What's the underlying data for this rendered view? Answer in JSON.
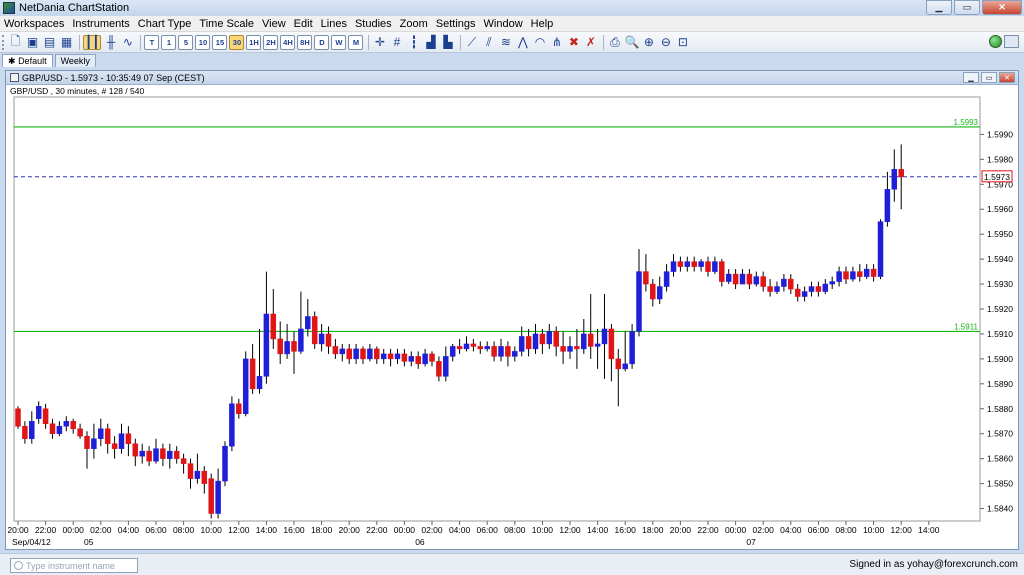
{
  "app": {
    "title": "NetDania ChartStation"
  },
  "window_controls": {
    "minimize": "▁",
    "maximize": "▭",
    "close": "✕"
  },
  "menu": [
    "Workspaces",
    "Instruments",
    "Chart Type",
    "Time Scale",
    "View",
    "Edit",
    "Lines",
    "Studies",
    "Zoom",
    "Settings",
    "Window",
    "Help"
  ],
  "toolbar": {
    "timeframes": [
      "T",
      "1",
      "5",
      "10",
      "15",
      "30",
      "1H",
      "2H",
      "4H",
      "8H",
      "D",
      "W",
      "M"
    ],
    "selected_timeframe": "30"
  },
  "tabs": [
    {
      "label": "Default",
      "star": "✱"
    },
    {
      "label": "Weekly",
      "star": ""
    }
  ],
  "chart_window": {
    "title": "GBP/USD - 1.5973 - 10:35:49  07 Sep (CEST)",
    "subtitle": "GBP/USD , 30 minutes, # 128 / 540",
    "controls": {
      "minimize": "▁",
      "maximize": "▭",
      "close": "✕"
    }
  },
  "search": {
    "placeholder": "Type instrument name"
  },
  "status": {
    "signed_in": "Signed in as yohay@forexcrunch.com"
  },
  "colors": {
    "up": "#1f1fd8",
    "down": "#e01515",
    "hline": "#17b617",
    "last": "#3030c0"
  },
  "chart_data": {
    "type": "candlestick",
    "ylim": [
      1.5835,
      1.6005
    ],
    "y_ticks": [
      "1.5840",
      "1.5850",
      "1.5860",
      "1.5870",
      "1.5880",
      "1.5890",
      "1.5900",
      "1.5910",
      "1.5920",
      "1.5930",
      "1.5940",
      "1.5950",
      "1.5960",
      "1.5970",
      "1.5980",
      "1.5990"
    ],
    "x_ticks": [
      {
        "label": "20:00",
        "index": 0
      },
      {
        "label": "22:00",
        "index": 4
      },
      {
        "label": "00:00",
        "index": 8
      },
      {
        "label": "02:00",
        "index": 12
      },
      {
        "label": "04:00",
        "index": 16
      },
      {
        "label": "06:00",
        "index": 20
      },
      {
        "label": "08:00",
        "index": 24
      },
      {
        "label": "10:00",
        "index": 28
      },
      {
        "label": "12:00",
        "index": 32
      },
      {
        "label": "14:00",
        "index": 36
      },
      {
        "label": "16:00",
        "index": 40
      },
      {
        "label": "18:00",
        "index": 44
      },
      {
        "label": "20:00",
        "index": 48
      },
      {
        "label": "22:00",
        "index": 52
      },
      {
        "label": "00:00",
        "index": 56
      },
      {
        "label": "02:00",
        "index": 60
      },
      {
        "label": "04:00",
        "index": 64
      },
      {
        "label": "06:00",
        "index": 68
      },
      {
        "label": "08:00",
        "index": 72
      },
      {
        "label": "10:00",
        "index": 76
      },
      {
        "label": "12:00",
        "index": 80
      },
      {
        "label": "14:00",
        "index": 84
      },
      {
        "label": "16:00",
        "index": 88
      },
      {
        "label": "18:00",
        "index": 92
      },
      {
        "label": "20:00",
        "index": 96
      },
      {
        "label": "22:00",
        "index": 100
      },
      {
        "label": "00:00",
        "index": 104
      },
      {
        "label": "02:00",
        "index": 108
      },
      {
        "label": "04:00",
        "index": 112
      },
      {
        "label": "06:00",
        "index": 116
      },
      {
        "label": "08:00",
        "index": 120
      },
      {
        "label": "10:00",
        "index": 124
      },
      {
        "label": "12:00",
        "index": 128
      },
      {
        "label": "14:00",
        "index": 132
      }
    ],
    "date_labels": [
      {
        "label": "Sep/04/12",
        "index": 0
      },
      {
        "label": "05",
        "index": 10
      },
      {
        "label": "06",
        "index": 58
      },
      {
        "label": "07",
        "index": 106
      }
    ],
    "hlines": [
      {
        "value": 1.5993,
        "label": "1.5993"
      },
      {
        "value": 1.5911,
        "label": "1.5911"
      }
    ],
    "last_price": {
      "value": 1.5973,
      "label": "1.5973"
    },
    "candles": [
      [
        1.588,
        1.5873,
        1.5881,
        1.5872
      ],
      [
        1.5873,
        1.5868,
        1.5875,
        1.5866
      ],
      [
        1.5868,
        1.5875,
        1.5879,
        1.5866
      ],
      [
        1.5876,
        1.5881,
        1.5883,
        1.5874
      ],
      [
        1.588,
        1.5874,
        1.5882,
        1.5872
      ],
      [
        1.5874,
        1.587,
        1.5876,
        1.5868
      ],
      [
        1.587,
        1.5873,
        1.5875,
        1.5869
      ],
      [
        1.5873,
        1.5875,
        1.5877,
        1.5871
      ],
      [
        1.5875,
        1.5872,
        1.5876,
        1.587
      ],
      [
        1.5872,
        1.5869,
        1.5874,
        1.5868
      ],
      [
        1.5869,
        1.5864,
        1.5871,
        1.5856
      ],
      [
        1.5864,
        1.5868,
        1.5874,
        1.586
      ],
      [
        1.5868,
        1.5872,
        1.5876,
        1.5865
      ],
      [
        1.5872,
        1.5866,
        1.5874,
        1.5862
      ],
      [
        1.5866,
        1.5864,
        1.5869,
        1.586
      ],
      [
        1.5864,
        1.587,
        1.5874,
        1.5862
      ],
      [
        1.587,
        1.5866,
        1.5873,
        1.5861
      ],
      [
        1.5866,
        1.5861,
        1.5868,
        1.5857
      ],
      [
        1.5861,
        1.5863,
        1.5866,
        1.5858
      ],
      [
        1.5863,
        1.5859,
        1.5865,
        1.5857
      ],
      [
        1.5859,
        1.5864,
        1.5868,
        1.5858
      ],
      [
        1.5864,
        1.586,
        1.5866,
        1.5857
      ],
      [
        1.586,
        1.5863,
        1.5866,
        1.5856
      ],
      [
        1.5863,
        1.586,
        1.5865,
        1.5858
      ],
      [
        1.586,
        1.5858,
        1.5862,
        1.5854
      ],
      [
        1.5858,
        1.5852,
        1.586,
        1.5848
      ],
      [
        1.5852,
        1.5855,
        1.5862,
        1.585
      ],
      [
        1.5855,
        1.585,
        1.5857,
        1.5846
      ],
      [
        1.5852,
        1.5838,
        1.5854,
        1.5836
      ],
      [
        1.5838,
        1.5851,
        1.5856,
        1.5836
      ],
      [
        1.5851,
        1.5865,
        1.5867,
        1.5849
      ],
      [
        1.5865,
        1.5882,
        1.5885,
        1.5863
      ],
      [
        1.5882,
        1.5878,
        1.5884,
        1.5876
      ],
      [
        1.5878,
        1.59,
        1.5903,
        1.5877
      ],
      [
        1.59,
        1.5888,
        1.5906,
        1.5886
      ],
      [
        1.5888,
        1.5893,
        1.5912,
        1.5886
      ],
      [
        1.5893,
        1.5918,
        1.5935,
        1.589
      ],
      [
        1.5918,
        1.5908,
        1.5928,
        1.5904
      ],
      [
        1.5908,
        1.5902,
        1.5915,
        1.5898
      ],
      [
        1.5902,
        1.5907,
        1.5914,
        1.59
      ],
      [
        1.5907,
        1.5903,
        1.5911,
        1.5894
      ],
      [
        1.5903,
        1.5912,
        1.5927,
        1.5902
      ],
      [
        1.5912,
        1.5917,
        1.5924,
        1.5909
      ],
      [
        1.5917,
        1.5906,
        1.5919,
        1.5904
      ],
      [
        1.5906,
        1.591,
        1.5914,
        1.5903
      ],
      [
        1.591,
        1.5905,
        1.5913,
        1.5902
      ],
      [
        1.5905,
        1.5902,
        1.5908,
        1.59
      ],
      [
        1.5902,
        1.5904,
        1.5906,
        1.5899
      ],
      [
        1.5904,
        1.59,
        1.5906,
        1.5898
      ],
      [
        1.59,
        1.5904,
        1.5906,
        1.5898
      ],
      [
        1.5904,
        1.59,
        1.5905,
        1.5898
      ],
      [
        1.59,
        1.5904,
        1.5906,
        1.5899
      ],
      [
        1.5904,
        1.59,
        1.5905,
        1.5898
      ],
      [
        1.59,
        1.5902,
        1.5904,
        1.5898
      ],
      [
        1.5902,
        1.59,
        1.5904,
        1.5897
      ],
      [
        1.59,
        1.5902,
        1.5904,
        1.5898
      ],
      [
        1.5902,
        1.5899,
        1.5904,
        1.5897
      ],
      [
        1.5899,
        1.5901,
        1.5903,
        1.5897
      ],
      [
        1.5901,
        1.5898,
        1.5903,
        1.5896
      ],
      [
        1.5898,
        1.5902,
        1.5904,
        1.5897
      ],
      [
        1.5902,
        1.5899,
        1.5903,
        1.5897
      ],
      [
        1.5899,
        1.5893,
        1.5901,
        1.5891
      ],
      [
        1.5893,
        1.5901,
        1.5905,
        1.5891
      ],
      [
        1.5901,
        1.5905,
        1.5906,
        1.5899
      ],
      [
        1.5905,
        1.5904,
        1.5908,
        1.5902
      ],
      [
        1.5904,
        1.5906,
        1.5909,
        1.5903
      ],
      [
        1.5906,
        1.5905,
        1.5908,
        1.5903
      ],
      [
        1.5905,
        1.5904,
        1.5907,
        1.5902
      ],
      [
        1.5904,
        1.5905,
        1.5907,
        1.5903
      ],
      [
        1.5905,
        1.5901,
        1.5907,
        1.5899
      ],
      [
        1.5901,
        1.5905,
        1.5908,
        1.5899
      ],
      [
        1.5905,
        1.5901,
        1.5907,
        1.5897
      ],
      [
        1.5901,
        1.5903,
        1.5905,
        1.5899
      ],
      [
        1.5903,
        1.5909,
        1.5913,
        1.5901
      ],
      [
        1.5909,
        1.5904,
        1.5912,
        1.5901
      ],
      [
        1.5904,
        1.591,
        1.5914,
        1.5902
      ],
      [
        1.591,
        1.5906,
        1.5912,
        1.5902
      ],
      [
        1.5906,
        1.5911,
        1.5914,
        1.5904
      ],
      [
        1.5911,
        1.5905,
        1.5913,
        1.5901
      ],
      [
        1.5905,
        1.5903,
        1.5911,
        1.5898
      ],
      [
        1.5903,
        1.5905,
        1.5909,
        1.59
      ],
      [
        1.5905,
        1.5904,
        1.5912,
        1.5896
      ],
      [
        1.5904,
        1.591,
        1.5916,
        1.5902
      ],
      [
        1.591,
        1.5905,
        1.5926,
        1.59
      ],
      [
        1.5905,
        1.5906,
        1.5912,
        1.5896
      ],
      [
        1.5906,
        1.5912,
        1.5926,
        1.5892
      ],
      [
        1.5912,
        1.59,
        1.5914,
        1.5891
      ],
      [
        1.59,
        1.5896,
        1.5904,
        1.5881
      ],
      [
        1.5896,
        1.5898,
        1.5911,
        1.5895
      ],
      [
        1.5898,
        1.5911,
        1.5914,
        1.5896
      ],
      [
        1.5911,
        1.5935,
        1.5944,
        1.5909
      ],
      [
        1.5935,
        1.593,
        1.5942,
        1.5927
      ],
      [
        1.593,
        1.5924,
        1.5932,
        1.5921
      ],
      [
        1.5924,
        1.5929,
        1.5933,
        1.5922
      ],
      [
        1.5929,
        1.5935,
        1.5938,
        1.5927
      ],
      [
        1.5935,
        1.5939,
        1.5942,
        1.5933
      ],
      [
        1.5939,
        1.5937,
        1.5941,
        1.5935
      ],
      [
        1.5937,
        1.5939,
        1.5941,
        1.5935
      ],
      [
        1.5939,
        1.5937,
        1.5941,
        1.5935
      ],
      [
        1.5937,
        1.5939,
        1.594,
        1.5935
      ],
      [
        1.5939,
        1.5935,
        1.5941,
        1.5933
      ],
      [
        1.5935,
        1.5939,
        1.5941,
        1.5934
      ],
      [
        1.5939,
        1.5931,
        1.594,
        1.5929
      ],
      [
        1.5931,
        1.5934,
        1.5936,
        1.593
      ],
      [
        1.5934,
        1.593,
        1.5936,
        1.5928
      ],
      [
        1.593,
        1.5934,
        1.5936,
        1.593
      ],
      [
        1.5934,
        1.593,
        1.5936,
        1.5928
      ],
      [
        1.593,
        1.5933,
        1.5935,
        1.5929
      ],
      [
        1.5933,
        1.5929,
        1.5935,
        1.5927
      ],
      [
        1.5929,
        1.5927,
        1.5932,
        1.5925
      ],
      [
        1.5927,
        1.5929,
        1.5931,
        1.5926
      ],
      [
        1.5929,
        1.5932,
        1.5934,
        1.5927
      ],
      [
        1.5932,
        1.5928,
        1.5934,
        1.5926
      ],
      [
        1.5928,
        1.5925,
        1.593,
        1.5923
      ],
      [
        1.5925,
        1.5927,
        1.5929,
        1.5923
      ],
      [
        1.5927,
        1.5929,
        1.5931,
        1.5925
      ],
      [
        1.5929,
        1.5927,
        1.5931,
        1.5925
      ],
      [
        1.5927,
        1.593,
        1.5932,
        1.5926
      ],
      [
        1.593,
        1.5931,
        1.5933,
        1.5928
      ],
      [
        1.5931,
        1.5935,
        1.5937,
        1.5929
      ],
      [
        1.5935,
        1.5932,
        1.5937,
        1.593
      ],
      [
        1.5932,
        1.5935,
        1.5937,
        1.5931
      ],
      [
        1.5935,
        1.5933,
        1.5938,
        1.5931
      ],
      [
        1.5933,
        1.5936,
        1.5938,
        1.5932
      ],
      [
        1.5936,
        1.5933,
        1.5938,
        1.5931
      ],
      [
        1.5933,
        1.5955,
        1.5956,
        1.5932
      ],
      [
        1.5955,
        1.5968,
        1.5975,
        1.5953
      ],
      [
        1.5968,
        1.5976,
        1.5984,
        1.5963
      ],
      [
        1.5976,
        1.5973,
        1.5986,
        1.596
      ]
    ]
  }
}
